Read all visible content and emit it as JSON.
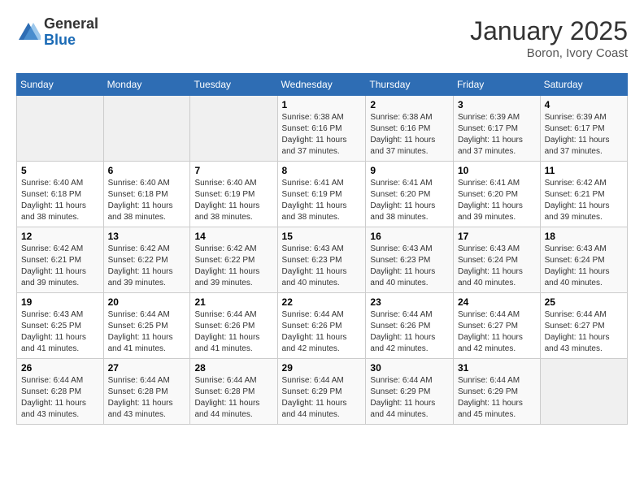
{
  "header": {
    "logo_general": "General",
    "logo_blue": "Blue",
    "month_title": "January 2025",
    "location": "Boron, Ivory Coast"
  },
  "days_of_week": [
    "Sunday",
    "Monday",
    "Tuesday",
    "Wednesday",
    "Thursday",
    "Friday",
    "Saturday"
  ],
  "weeks": [
    [
      {
        "day": "",
        "info": ""
      },
      {
        "day": "",
        "info": ""
      },
      {
        "day": "",
        "info": ""
      },
      {
        "day": "1",
        "info": "Sunrise: 6:38 AM\nSunset: 6:16 PM\nDaylight: 11 hours and 37 minutes."
      },
      {
        "day": "2",
        "info": "Sunrise: 6:38 AM\nSunset: 6:16 PM\nDaylight: 11 hours and 37 minutes."
      },
      {
        "day": "3",
        "info": "Sunrise: 6:39 AM\nSunset: 6:17 PM\nDaylight: 11 hours and 37 minutes."
      },
      {
        "day": "4",
        "info": "Sunrise: 6:39 AM\nSunset: 6:17 PM\nDaylight: 11 hours and 37 minutes."
      }
    ],
    [
      {
        "day": "5",
        "info": "Sunrise: 6:40 AM\nSunset: 6:18 PM\nDaylight: 11 hours and 38 minutes."
      },
      {
        "day": "6",
        "info": "Sunrise: 6:40 AM\nSunset: 6:18 PM\nDaylight: 11 hours and 38 minutes."
      },
      {
        "day": "7",
        "info": "Sunrise: 6:40 AM\nSunset: 6:19 PM\nDaylight: 11 hours and 38 minutes."
      },
      {
        "day": "8",
        "info": "Sunrise: 6:41 AM\nSunset: 6:19 PM\nDaylight: 11 hours and 38 minutes."
      },
      {
        "day": "9",
        "info": "Sunrise: 6:41 AM\nSunset: 6:20 PM\nDaylight: 11 hours and 38 minutes."
      },
      {
        "day": "10",
        "info": "Sunrise: 6:41 AM\nSunset: 6:20 PM\nDaylight: 11 hours and 39 minutes."
      },
      {
        "day": "11",
        "info": "Sunrise: 6:42 AM\nSunset: 6:21 PM\nDaylight: 11 hours and 39 minutes."
      }
    ],
    [
      {
        "day": "12",
        "info": "Sunrise: 6:42 AM\nSunset: 6:21 PM\nDaylight: 11 hours and 39 minutes."
      },
      {
        "day": "13",
        "info": "Sunrise: 6:42 AM\nSunset: 6:22 PM\nDaylight: 11 hours and 39 minutes."
      },
      {
        "day": "14",
        "info": "Sunrise: 6:42 AM\nSunset: 6:22 PM\nDaylight: 11 hours and 39 minutes."
      },
      {
        "day": "15",
        "info": "Sunrise: 6:43 AM\nSunset: 6:23 PM\nDaylight: 11 hours and 40 minutes."
      },
      {
        "day": "16",
        "info": "Sunrise: 6:43 AM\nSunset: 6:23 PM\nDaylight: 11 hours and 40 minutes."
      },
      {
        "day": "17",
        "info": "Sunrise: 6:43 AM\nSunset: 6:24 PM\nDaylight: 11 hours and 40 minutes."
      },
      {
        "day": "18",
        "info": "Sunrise: 6:43 AM\nSunset: 6:24 PM\nDaylight: 11 hours and 40 minutes."
      }
    ],
    [
      {
        "day": "19",
        "info": "Sunrise: 6:43 AM\nSunset: 6:25 PM\nDaylight: 11 hours and 41 minutes."
      },
      {
        "day": "20",
        "info": "Sunrise: 6:44 AM\nSunset: 6:25 PM\nDaylight: 11 hours and 41 minutes."
      },
      {
        "day": "21",
        "info": "Sunrise: 6:44 AM\nSunset: 6:26 PM\nDaylight: 11 hours and 41 minutes."
      },
      {
        "day": "22",
        "info": "Sunrise: 6:44 AM\nSunset: 6:26 PM\nDaylight: 11 hours and 42 minutes."
      },
      {
        "day": "23",
        "info": "Sunrise: 6:44 AM\nSunset: 6:26 PM\nDaylight: 11 hours and 42 minutes."
      },
      {
        "day": "24",
        "info": "Sunrise: 6:44 AM\nSunset: 6:27 PM\nDaylight: 11 hours and 42 minutes."
      },
      {
        "day": "25",
        "info": "Sunrise: 6:44 AM\nSunset: 6:27 PM\nDaylight: 11 hours and 43 minutes."
      }
    ],
    [
      {
        "day": "26",
        "info": "Sunrise: 6:44 AM\nSunset: 6:28 PM\nDaylight: 11 hours and 43 minutes."
      },
      {
        "day": "27",
        "info": "Sunrise: 6:44 AM\nSunset: 6:28 PM\nDaylight: 11 hours and 43 minutes."
      },
      {
        "day": "28",
        "info": "Sunrise: 6:44 AM\nSunset: 6:28 PM\nDaylight: 11 hours and 44 minutes."
      },
      {
        "day": "29",
        "info": "Sunrise: 6:44 AM\nSunset: 6:29 PM\nDaylight: 11 hours and 44 minutes."
      },
      {
        "day": "30",
        "info": "Sunrise: 6:44 AM\nSunset: 6:29 PM\nDaylight: 11 hours and 44 minutes."
      },
      {
        "day": "31",
        "info": "Sunrise: 6:44 AM\nSunset: 6:29 PM\nDaylight: 11 hours and 45 minutes."
      },
      {
        "day": "",
        "info": ""
      }
    ]
  ]
}
